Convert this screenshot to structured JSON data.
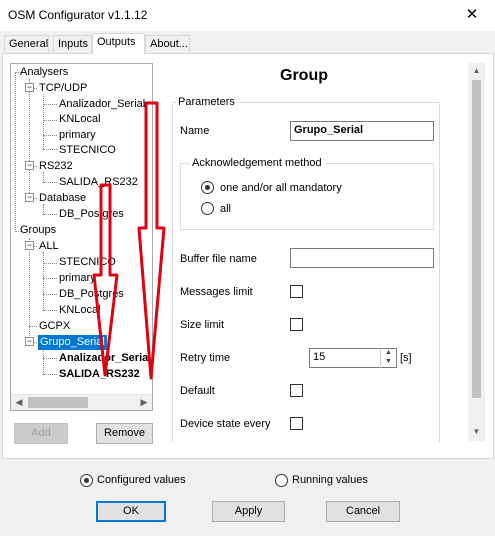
{
  "window": {
    "title": "OSM Configurator v1.1.12",
    "close_glyph": "✕"
  },
  "tabs": [
    {
      "label": "General"
    },
    {
      "label": "Inputs"
    },
    {
      "label": "Outputs"
    },
    {
      "label": "About..."
    }
  ],
  "tree": {
    "analysers": "Analysers",
    "tcp_udp": "TCP/UDP",
    "tcp_children": [
      "Analizador_Serial",
      "KNLocal",
      "primary",
      "STECNICO"
    ],
    "rs232": "RS232",
    "rs232_children": [
      "SALIDA_RS232"
    ],
    "database": "Database",
    "database_children": [
      "DB_Postgres"
    ],
    "groups": "Groups",
    "all": "ALL",
    "all_children": [
      "STECNICO",
      "primary",
      "DB_Postgres",
      "KNLocal"
    ],
    "gcpx": "GCPX",
    "grupo_serial": "Grupo_Serial",
    "grupo_children": [
      "Analizador_Serial",
      "SALIDA_RS232"
    ],
    "collapse_glyph": "−"
  },
  "tree_buttons": {
    "add": "Add",
    "remove": "Remove"
  },
  "form": {
    "heading": "Group",
    "parameters_label": "Parameters",
    "name_label": "Name",
    "name_value": "Grupo_Serial",
    "ack_label": "Acknowledgement method",
    "ack_options": [
      "one and/or all mandatory",
      "all"
    ],
    "ack_selected": "one and/or all mandatory",
    "buffer_label": "Buffer file name",
    "buffer_value": "",
    "messages_limit_label": "Messages limit",
    "size_limit_label": "Size limit",
    "retry_label": "Retry time",
    "retry_value": "15",
    "retry_unit": "[s]",
    "default_label": "Default",
    "device_state_label": "Device state every"
  },
  "mode": {
    "options": [
      "Configured values",
      "Running values"
    ],
    "selected": "Configured values"
  },
  "footer_buttons": {
    "ok": "OK",
    "apply": "Apply",
    "cancel": "Cancel"
  },
  "colors": {
    "selection": "#0078d7",
    "arrow": "#e0000f"
  }
}
